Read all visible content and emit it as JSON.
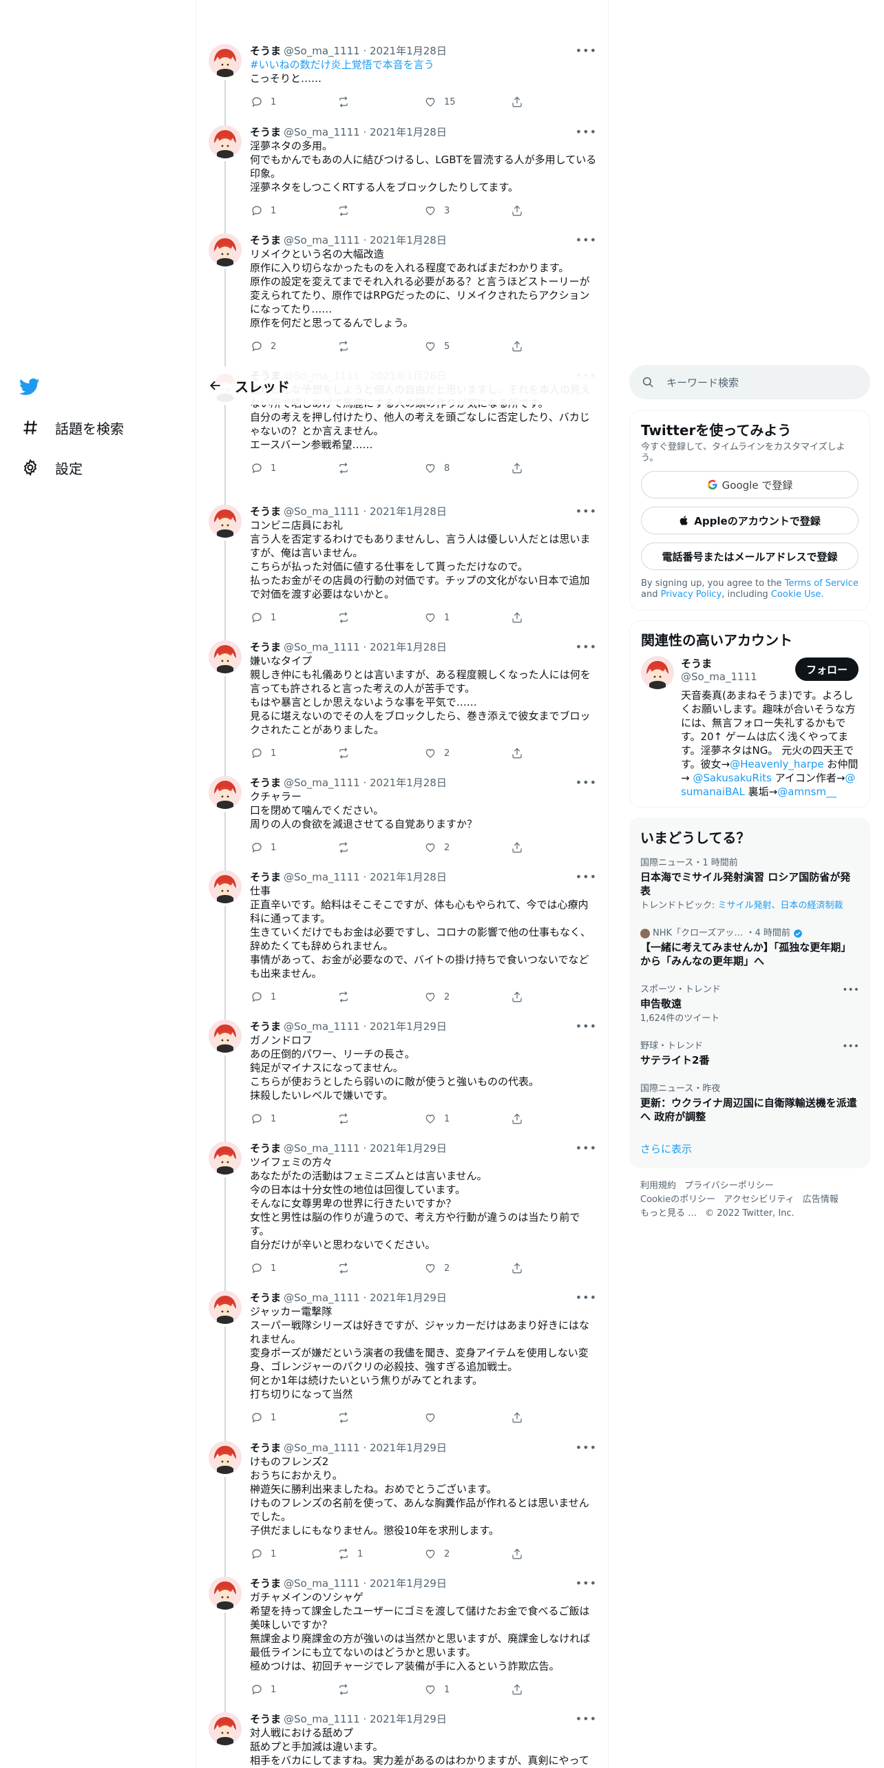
{
  "nav": {
    "items": [
      {
        "label": "話題を検索"
      },
      {
        "label": "設定"
      }
    ]
  },
  "header": {
    "title": "スレッド"
  },
  "tweets": [
    {
      "name": "そうま",
      "handle": "@So_ma_1111",
      "date": "2021年1月28日",
      "hashtag": "#いいねの数だけ炎上覚悟で本音を言う",
      "text": "こっそりと……",
      "replies": "1",
      "retweets": "",
      "likes": "15"
    },
    {
      "name": "そうま",
      "handle": "@So_ma_1111",
      "date": "2021年1月28日",
      "text": "淫夢ネタの多用。\n何でもかんでもあの人に結びつけるし、LGBTを冒涜する人が多用している印象。\n淫夢ネタをしつこくRTする人をブロックしたりしてます。",
      "replies": "1",
      "retweets": "",
      "likes": "3"
    },
    {
      "name": "そうま",
      "handle": "@So_ma_1111",
      "date": "2021年1月28日",
      "text": "リメイクという名の大幅改造\n原作に入り切らなかったものを入れる程度であればまだわかります。\n原作の設定を変えてまでそれ入れる必要がある？と言うほどストーリーが変えられてたり、原作ではRPGだったのに、リメイクされたらアクションになってたり……\n原作を何だと思ってるんでしょう。",
      "replies": "2",
      "retweets": "",
      "likes": "5"
    },
    {
      "name": "そうま",
      "handle": "@So_ma_1111",
      "date": "2021年1月28日",
      "text": "誰がどんな予想をしようと個人の自由だと思いますし、それを本人の見えない所で晒しあげて馬鹿にする人の頭の作りが気になる所です。\n自分の考えを押し付けたり、他人の考えを頭ごなしに否定したり、バカじゃないの？とか言えません。\nエースバーン参戦希望……",
      "replies": "1",
      "retweets": "",
      "likes": "8"
    },
    {
      "name": "そうま",
      "handle": "@So_ma_1111",
      "date": "2021年1月28日",
      "text": "コンビニ店員にお礼\n言う人を否定するわけでもありませんし、言う人は優しい人だとは思いますが、俺は言いません。\nこちらが払った対価に値する仕事をして貰っただけなので。\n払ったお金がその店員の行動の対価です。チップの文化がない日本で追加で対価を渡す必要はないかと。",
      "replies": "1",
      "retweets": "",
      "likes": "1"
    },
    {
      "name": "そうま",
      "handle": "@So_ma_1111",
      "date": "2021年1月28日",
      "text": "嫌いなタイプ\n親しき仲にも礼儀ありとは言いますが、ある程度親しくなった人には何を言っても許されると言った考えの人が苦手です。\nもはや暴言としか思えないような事を平気で……\n見るに堪えないのでその人をブロックしたら、巻き添えで彼女までブロックされたことがありました。",
      "replies": "1",
      "retweets": "",
      "likes": "2"
    },
    {
      "name": "そうま",
      "handle": "@So_ma_1111",
      "date": "2021年1月28日",
      "text": "クチャラー\n口を閉めて噛んでください。\n周りの人の食欲を減退させてる自覚ありますか？",
      "replies": "1",
      "retweets": "",
      "likes": "2"
    },
    {
      "name": "そうま",
      "handle": "@So_ma_1111",
      "date": "2021年1月28日",
      "text": "仕事\n正直辛いです。給料はそこそこですが、体も心もやられて、今では心療内科に通ってます。\n生きていくだけでもお金は必要ですし、コロナの影響で他の仕事もなく、辞めたくても辞められません。\n事情があって、お金が必要なので、バイトの掛け持ちで食いつないでなども出来ません。",
      "replies": "1",
      "retweets": "",
      "likes": "2"
    },
    {
      "name": "そうま",
      "handle": "@So_ma_1111",
      "date": "2021年1月29日",
      "text": "ガノンドロフ\nあの圧倒的パワー、リーチの長さ。\n鈍足がマイナスになってません。\nこちらが使おうとしたら弱いのに敵が使うと強いものの代表。\n抹殺したいレベルで嫌いです。",
      "replies": "1",
      "retweets": "",
      "likes": "1"
    },
    {
      "name": "そうま",
      "handle": "@So_ma_1111",
      "date": "2021年1月29日",
      "text": "ツイフェミの方々\nあなたがたの活動はフェミニズムとは言いません。\n今の日本は十分女性の地位は回復しています。\nそんなに女尊男卑の世界に行きたいですか？\n女性と男性は脳の作りが違うので、考え方や行動が違うのは当たり前です。\n自分だけが辛いと思わないでください。",
      "replies": "1",
      "retweets": "",
      "likes": "2"
    },
    {
      "name": "そうま",
      "handle": "@So_ma_1111",
      "date": "2021年1月29日",
      "text": "ジャッカー電撃隊\nスーパー戦隊シリーズは好きですが、ジャッカーだけはあまり好きにはなれません。\n変身ポーズが嫌だという演者の我儘を聞き、変身アイテムを使用しない変身、ゴレンジャーのパクリの必殺技、強すぎる追加戦士。\n何とか1年は続けたいという焦りがみてとれます。\n打ち切りになって当然",
      "replies": "1",
      "retweets": "",
      "likes": ""
    },
    {
      "name": "そうま",
      "handle": "@So_ma_1111",
      "date": "2021年1月29日",
      "text": "けものフレンズ2\nおうちにおかえり。\n榊遊矢に勝利出来ましたね。おめでとうございます。\nけものフレンズの名前を使って、あんな胸糞作品が作れるとは思いませんでした。\n子供だましにもなりません。懲役10年を求刑します。",
      "replies": "1",
      "retweets": "1",
      "likes": "2"
    },
    {
      "name": "そうま",
      "handle": "@So_ma_1111",
      "date": "2021年1月29日",
      "text": "ガチャメインのソシャゲ\n希望を持って課金したユーザーにゴミを渡して儲けたお金で食べるご飯は美味しいですか？\n無課金より廃課金の方が強いのは当然かと思いますが、廃課金しなければ最低ラインにも立てないのはどうかと思います。\n極めつけは、初回チャージでレア装備が手に入るという詐欺広告。",
      "replies": "1",
      "retweets": "",
      "likes": "1"
    },
    {
      "name": "そうま",
      "handle": "@So_ma_1111",
      "date": "2021年1月29日",
      "text": "対人戦における舐めプ\n舐めプと手加減は違います。\n相手をバカにしてますね。実力差があるのはわかりますが、真剣にやって",
      "replies": "",
      "retweets": "",
      "likes": ""
    }
  ],
  "search": {
    "placeholder": "キーワード検索"
  },
  "signup": {
    "title": "Twitterを使ってみよう",
    "subtitle": "今すぐ登録して、タイムラインをカスタマイズしよう。",
    "google": "Google で登録",
    "apple": "Appleのアカウントで登録",
    "phone": "電話番号またはメールアドレスで登録",
    "legal_pre": "By signing up, you agree to the",
    "terms": "Terms of Service",
    "legal_and": "and",
    "privacy": "Privacy Policy",
    "legal_incl": ", including",
    "cookie": "Cookie Use."
  },
  "related": {
    "title": "関連性の高いアカウント",
    "name": "そうま",
    "handle": "@So_ma_1111",
    "follow": "フォロー",
    "bio_1": "天音奏真(あまねそうま)です。よろしくお願いします。趣味が合いそうな方には、無言フォロー失礼するかもです。20↑ ゲームは広く浅くやってます。淫夢ネタはNG。 元火の四天王です。彼女→",
    "bio_link1": "@Heavenly_harpe",
    "bio_2": " お仲間→ ",
    "bio_link2": "@SakusakuRits",
    "bio_3": " アイコン作者→",
    "bio_link3": "@sumanaiBAL",
    "bio_4": " 裏垢→",
    "bio_link4": "@amnsm__"
  },
  "trends": {
    "title": "いまどうしてる？",
    "items": [
      {
        "meta": "国際ニュース・1 時間前",
        "title": "日本海でミサイル発射演習 ロシア国防省が発表",
        "sub_label": "トレンドトピック: ",
        "sub_link": "ミサイル発射、日本の経済制裁"
      },
      {
        "meta": "NHK「クローズアッ… ・4 時間前",
        "title": "【一緒に考えてみませんか】「孤独な更年期」から「みんなの更年期」へ"
      },
      {
        "meta": "スポーツ・トレンド",
        "title": "申告敬遠",
        "sub": "1,624件のツイート"
      },
      {
        "meta": "野球・トレンド",
        "title": "サテライト2番"
      },
      {
        "meta": "国際ニュース・昨夜",
        "title": "更新：ウクライナ周辺国に自衛隊輸送機を派遣へ 政府が調整"
      }
    ],
    "show_more": "さらに表示"
  },
  "footer": {
    "terms": "利用規約",
    "privacy": "プライバシーポリシー",
    "cookie": "Cookieのポリシー",
    "accessibility": "アクセシビリティ",
    "ads": "広告情報",
    "more": "もっと見る …",
    "copyright": "© 2022 Twitter, Inc."
  },
  "colors": {
    "accent": "#1d9bf0",
    "text": "#0f1419",
    "muted": "#536471"
  }
}
